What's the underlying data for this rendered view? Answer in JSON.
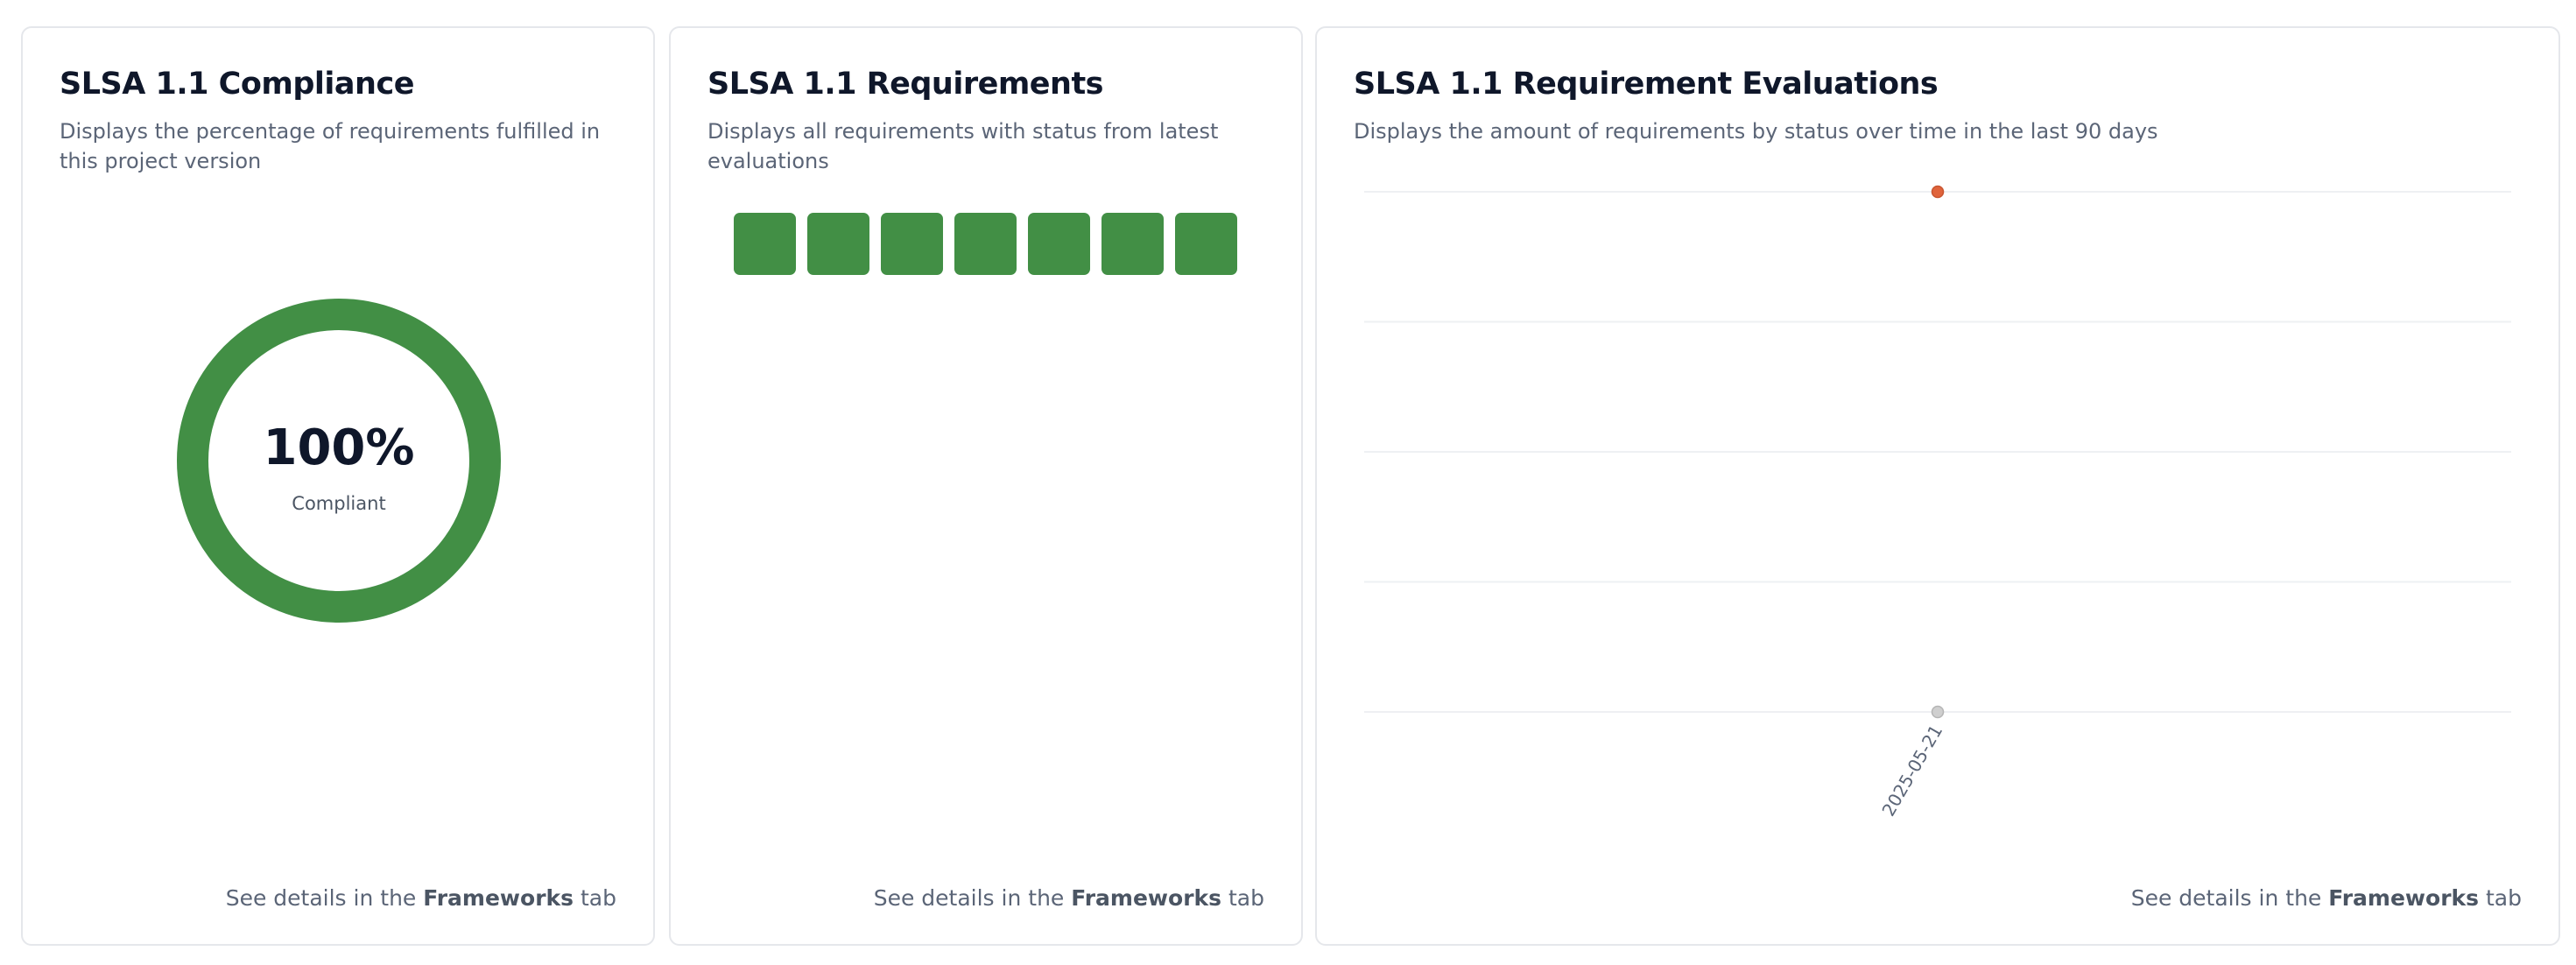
{
  "compliance_card": {
    "title": "SLSA 1.1 Compliance",
    "description": "Displays the percentage of requirements fulfilled in this project version",
    "percent_label": "100%",
    "percent_value": 100,
    "status_label": "Compliant",
    "ring_color": "#428f45",
    "footer_prefix": "See details in the ",
    "footer_link": "Frameworks",
    "footer_suffix": " tab"
  },
  "requirements_card": {
    "title": "SLSA 1.1 Requirements",
    "description": "Displays all requirements with status from latest evaluations",
    "requirements": [
      {
        "status": "fulfilled"
      },
      {
        "status": "fulfilled"
      },
      {
        "status": "fulfilled"
      },
      {
        "status": "fulfilled"
      },
      {
        "status": "fulfilled"
      },
      {
        "status": "fulfilled"
      },
      {
        "status": "fulfilled"
      }
    ],
    "status_color": "#428f45",
    "footer_prefix": "See details in the ",
    "footer_link": "Frameworks",
    "footer_suffix": " tab"
  },
  "evaluations_card": {
    "title": "SLSA 1.1 Requirement Evaluations",
    "description": "Displays the amount of requirements by status over time in the last 90 days",
    "footer_prefix": "See details in the ",
    "footer_link": "Frameworks",
    "footer_suffix": " tab"
  },
  "chart_data": {
    "type": "line",
    "title": "",
    "xlabel": "",
    "ylabel": "",
    "x": [
      "2025-05-21"
    ],
    "series": [
      {
        "values": [
          7
        ],
        "color": "#e0643c"
      },
      {
        "values": [
          0
        ],
        "color": "#cfcfcf"
      }
    ],
    "ylim": [
      0,
      7
    ],
    "grid": true,
    "gridline_count": 5,
    "x_tick_rotation": -60,
    "legend": "none"
  }
}
